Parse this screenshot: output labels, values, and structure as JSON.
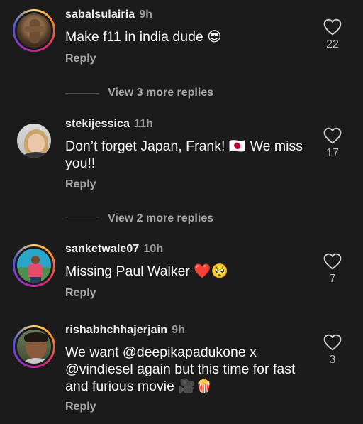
{
  "comments": [
    {
      "username": "sabalsulairia",
      "time": "9h",
      "text": "Make f11 in india dude 😎",
      "reply_label": "Reply",
      "likes": "22",
      "avatar_ring": true,
      "avatar_icon": "statue-photo"
    },
    {
      "username": "stekijessica",
      "time": "11h",
      "text": "Don’t forget Japan, Frank! 🇯🇵 We miss you!!",
      "reply_label": "Reply",
      "likes": "17",
      "avatar_ring": false,
      "avatar_icon": "woman-photo"
    },
    {
      "username": "sanketwale07",
      "time": "10h",
      "text": "Missing Paul Walker ❤️🥺",
      "reply_label": "Reply",
      "likes": "7",
      "avatar_ring": true,
      "avatar_icon": "man-beach-photo"
    },
    {
      "username": "rishabhchhajerjain",
      "time": "9h",
      "text": "We want @deepikapadukone x @vindiesel again but this time for fast and furious movie 🎥🍿",
      "reply_label": "Reply",
      "likes": "3",
      "avatar_ring": true,
      "avatar_icon": "child-photo"
    }
  ],
  "more_replies": [
    {
      "label": "View 3 more replies"
    },
    {
      "label": "View 2 more replies"
    }
  ],
  "colors": {
    "background": "#1b1b1b",
    "text": "#f7f7f7",
    "muted": "#a9a9a9"
  }
}
